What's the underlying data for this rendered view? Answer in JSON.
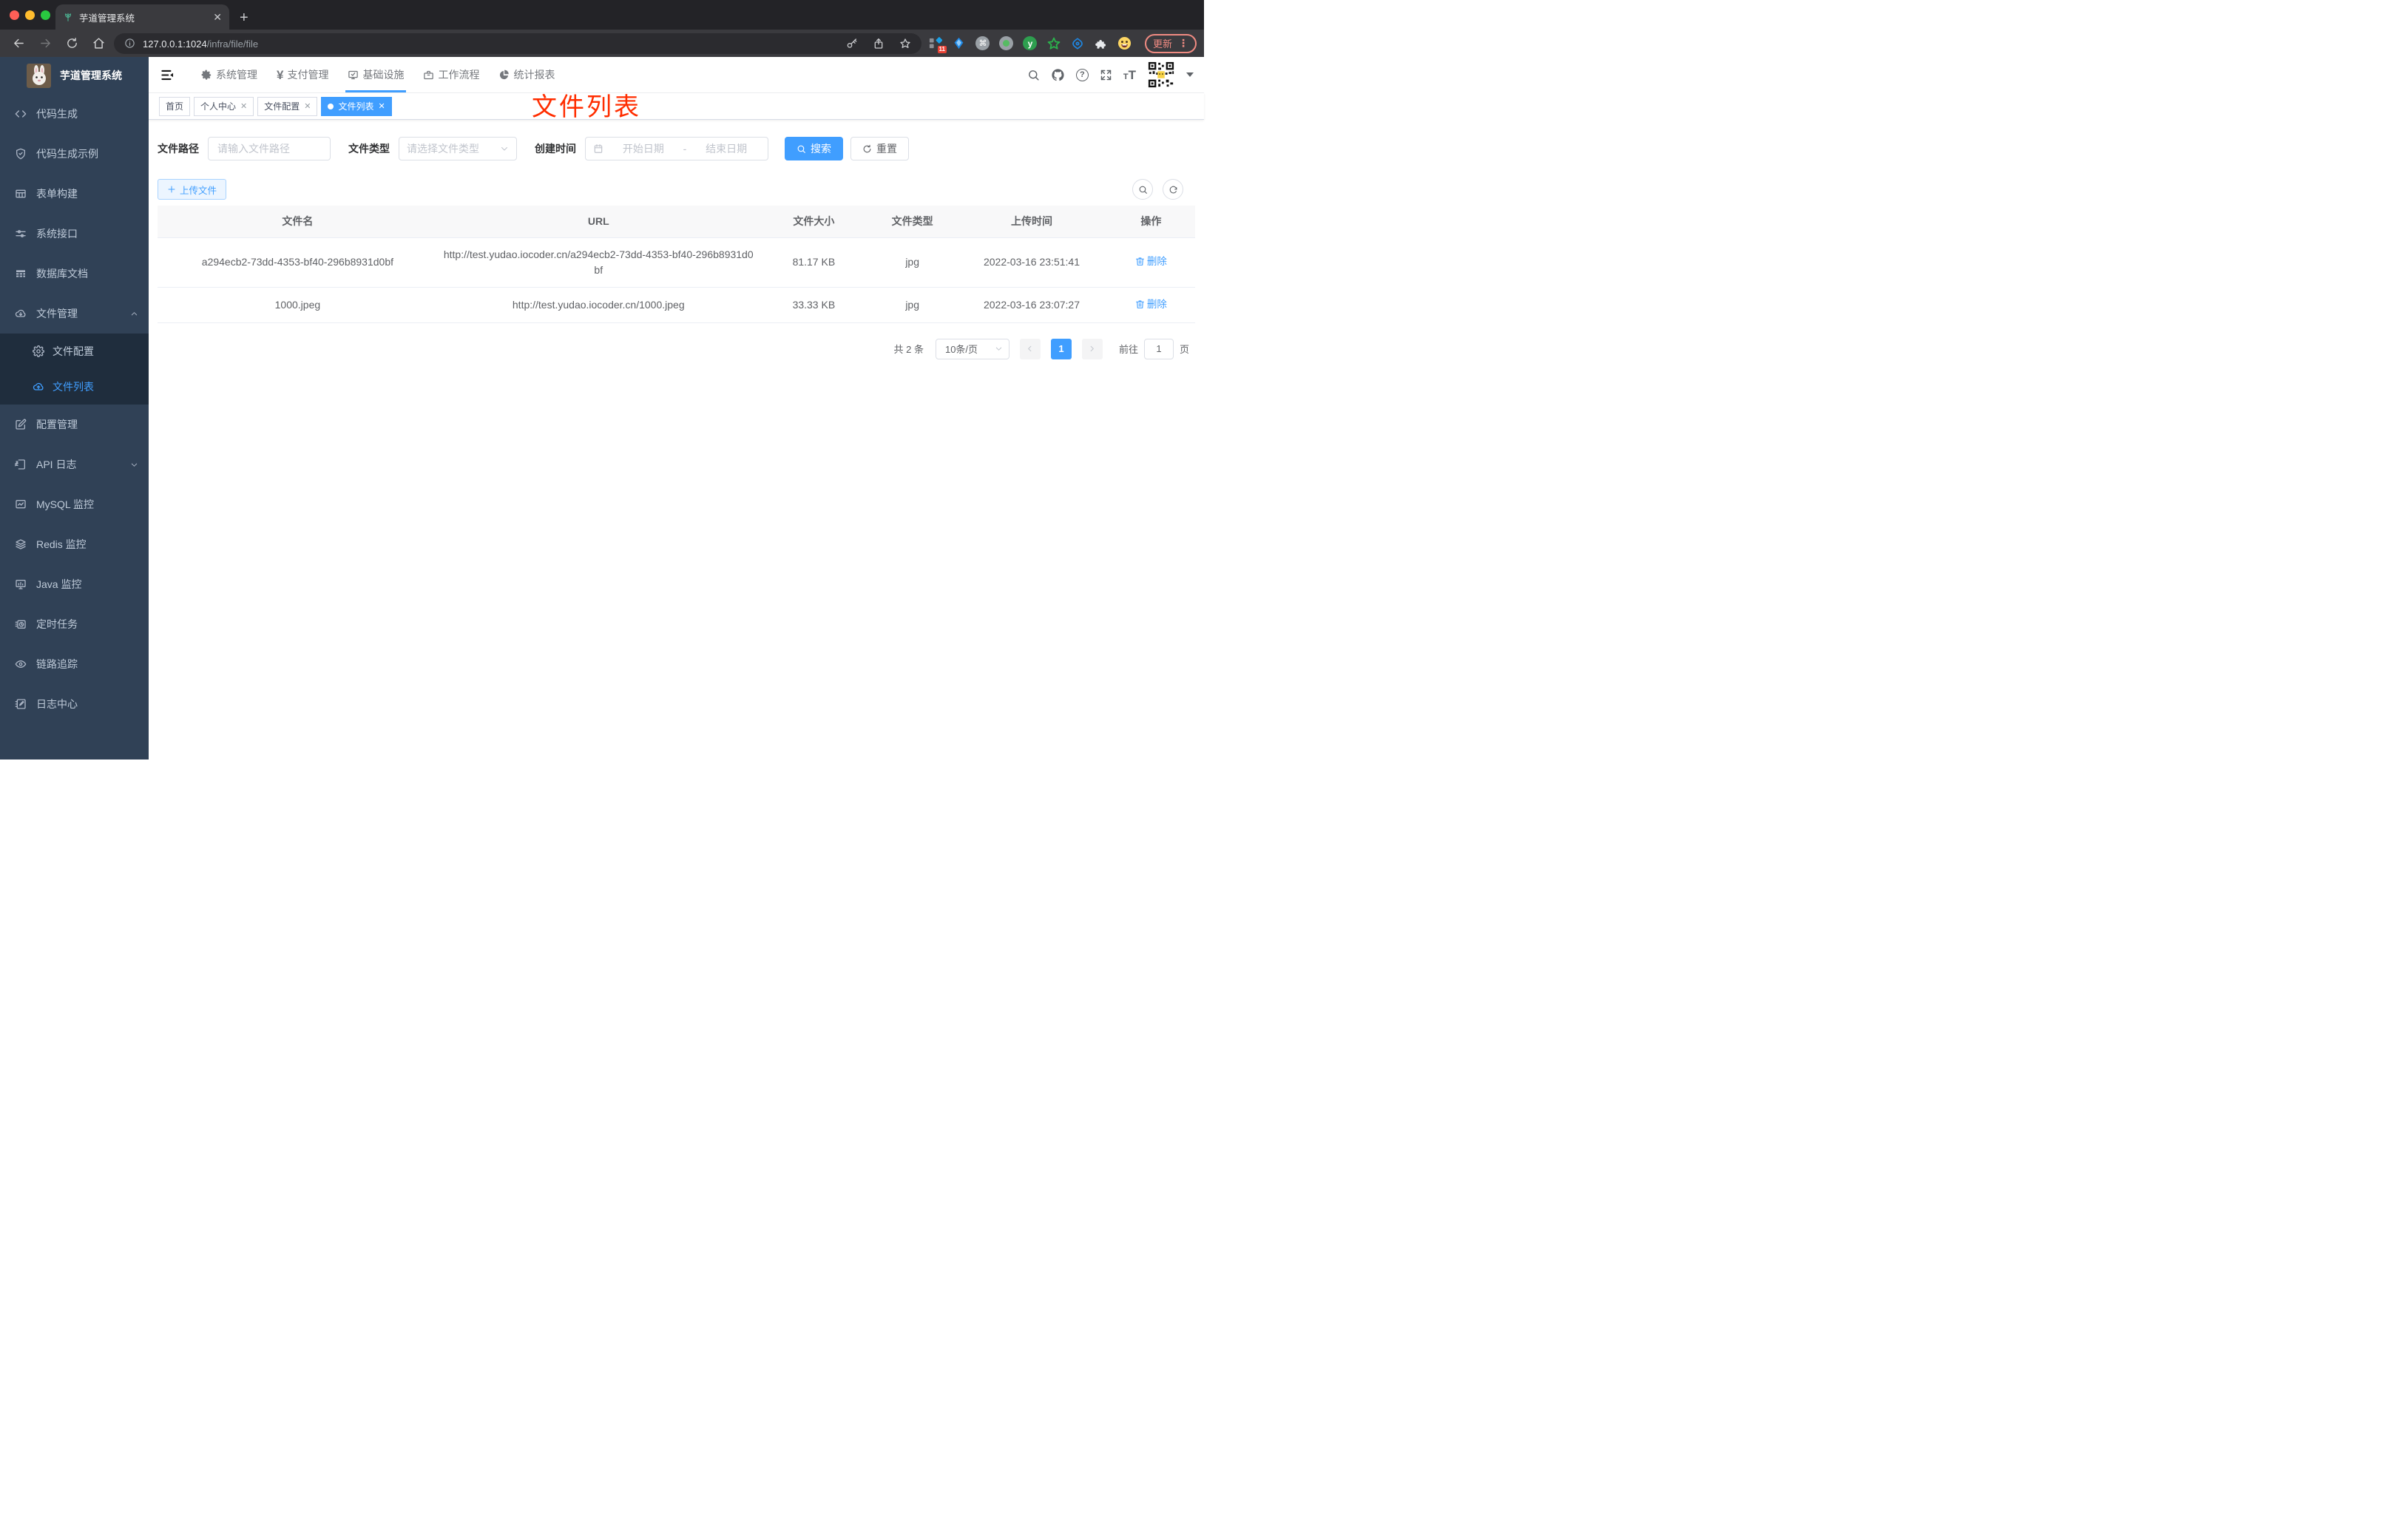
{
  "browser": {
    "tab_title": "芋道管理系统",
    "url_host": "127.0.0.1:1024",
    "url_path": "/infra/file/file",
    "extension_badge": "11",
    "update_label": "更新"
  },
  "sidebar": {
    "title": "芋道管理系统",
    "items": [
      {
        "label": "代码生成"
      },
      {
        "label": "代码生成示例"
      },
      {
        "label": "表单构建"
      },
      {
        "label": "系统接口"
      },
      {
        "label": "数据库文档"
      },
      {
        "label": "文件管理"
      },
      {
        "label": "配置管理"
      },
      {
        "label": "API 日志"
      },
      {
        "label": "MySQL 监控"
      },
      {
        "label": "Redis 监控"
      },
      {
        "label": "Java 监控"
      },
      {
        "label": "定时任务"
      },
      {
        "label": "链路追踪"
      },
      {
        "label": "日志中心"
      }
    ],
    "submenu": [
      {
        "label": "文件配置",
        "active": false
      },
      {
        "label": "文件列表",
        "active": true
      }
    ]
  },
  "topnav": {
    "menus": [
      {
        "label": "系统管理"
      },
      {
        "label": "支付管理"
      },
      {
        "label": "基础设施",
        "active": true
      },
      {
        "label": "工作流程"
      },
      {
        "label": "统计报表"
      }
    ],
    "yen_glyph": "¥"
  },
  "tags": [
    {
      "label": "首页",
      "closable": false
    },
    {
      "label": "个人中心",
      "closable": true
    },
    {
      "label": "文件配置",
      "closable": true
    },
    {
      "label": "文件列表",
      "closable": true,
      "active": true
    }
  ],
  "annotation": "文件列表",
  "filters": {
    "file_path_label": "文件路径",
    "file_path_placeholder": "请输入文件路径",
    "file_type_label": "文件类型",
    "file_type_placeholder": "请选择文件类型",
    "create_time_label": "创建时间",
    "start_placeholder": "开始日期",
    "separator": "-",
    "end_placeholder": "结束日期",
    "search_label": "搜索",
    "reset_label": "重置"
  },
  "toolbar": {
    "upload_label": "上传文件"
  },
  "table": {
    "headers": [
      "文件名",
      "URL",
      "文件大小",
      "文件类型",
      "上传时间",
      "操作"
    ],
    "rows": [
      {
        "name": "a294ecb2-73dd-4353-bf40-296b8931d0bf",
        "url": "http://test.yudao.iocoder.cn/a294ecb2-73dd-4353-bf40-296b8931d0bf",
        "size": "81.17 KB",
        "type": "jpg",
        "time": "2022-03-16 23:51:41",
        "action": "删除"
      },
      {
        "name": "1000.jpeg",
        "url": "http://test.yudao.iocoder.cn/1000.jpeg",
        "size": "33.33 KB",
        "type": "jpg",
        "time": "2022-03-16 23:07:27",
        "action": "删除"
      }
    ]
  },
  "pagination": {
    "total": "共 2 条",
    "page_size": "10条/页",
    "current_page": "1",
    "goto_label": "前往",
    "goto_value": "1",
    "page_unit": "页"
  },
  "colors": {
    "primary": "#409EFF",
    "annotation_red": "#FF2D00",
    "sidebar_bg": "#304156",
    "submenu_bg": "#1F2D3D"
  }
}
